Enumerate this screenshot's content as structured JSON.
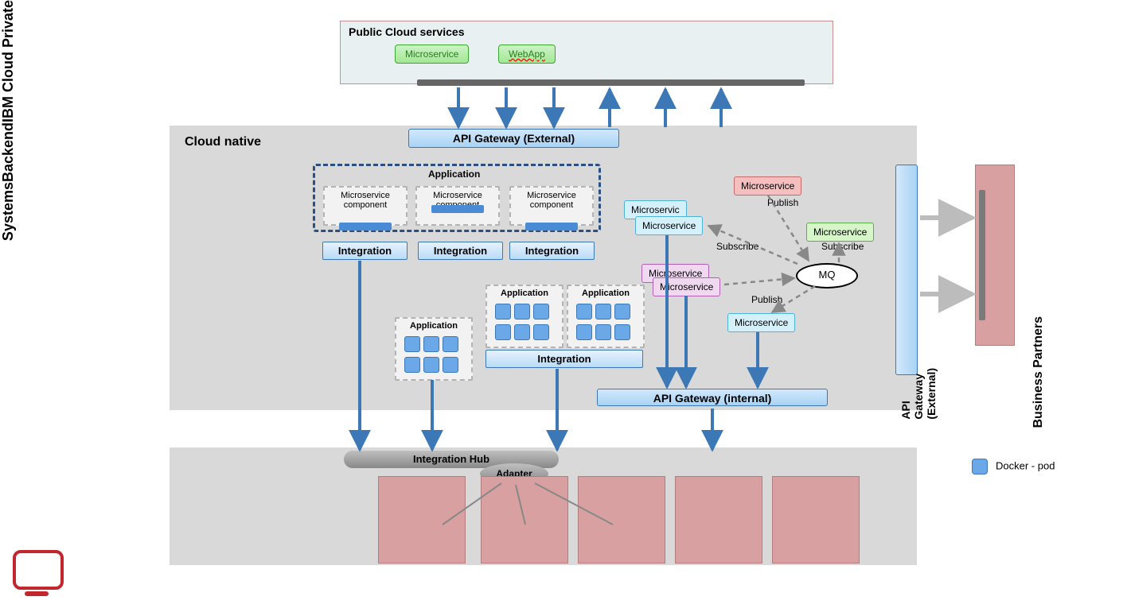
{
  "public": {
    "title": "Public Cloud services",
    "ms": "Microservice",
    "webapp": "WebApp"
  },
  "cloudNative": {
    "title": "Cloud native"
  },
  "api": {
    "external": "API Gateway (External)",
    "internal": "API Gateway (internal)",
    "sideExternal": "API Gateway (External)"
  },
  "appGroup": {
    "title": "Application",
    "comp": "Microservice component"
  },
  "integration": "Integration",
  "integrationHub": "Integration Hub",
  "adapter": "Adapter",
  "mq": "MQ",
  "pubsub": {
    "publish": "Publish",
    "subscribe": "Subscribe"
  },
  "labels": {
    "icp": "IBM Cloud Private",
    "backend": "Backend",
    "systems": "Systems",
    "bp": "Business Partners"
  },
  "legend": "Docker - pod",
  "msWord": "Microservice",
  "msWord2": "Microservic"
}
